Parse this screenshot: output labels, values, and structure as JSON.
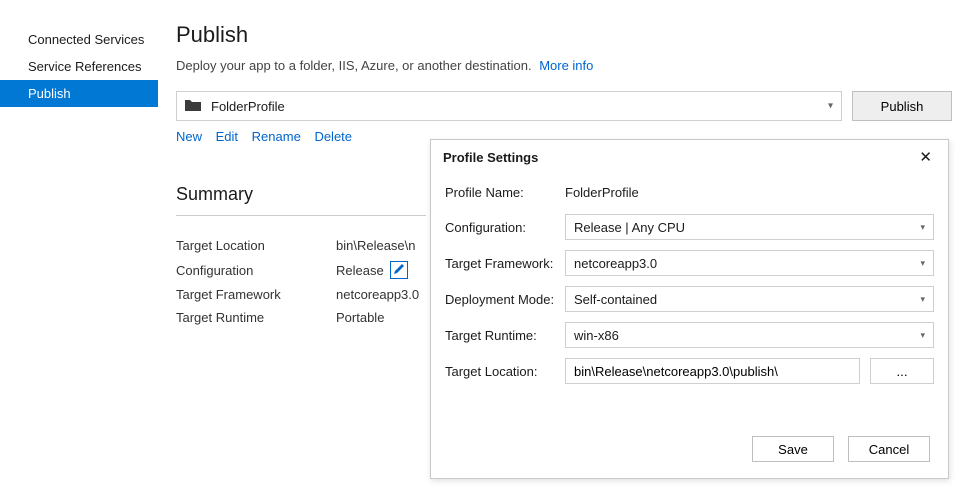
{
  "sidebar": {
    "items": [
      {
        "label": "Connected Services",
        "selected": false
      },
      {
        "label": "Service References",
        "selected": false
      },
      {
        "label": "Publish",
        "selected": true
      }
    ]
  },
  "page": {
    "title": "Publish",
    "subtitle": "Deploy your app to a folder, IIS, Azure, or another destination.",
    "more_info": "More info"
  },
  "profile": {
    "selected": "FolderProfile",
    "publish_button": "Publish",
    "actions": {
      "new": "New",
      "edit": "Edit",
      "rename": "Rename",
      "delete": "Delete"
    }
  },
  "summary": {
    "title": "Summary",
    "rows": {
      "target_location": {
        "label": "Target Location",
        "value": "bin\\Release\\n"
      },
      "configuration": {
        "label": "Configuration",
        "value": "Release"
      },
      "target_framework": {
        "label": "Target Framework",
        "value": "netcoreapp3.0"
      },
      "target_runtime": {
        "label": "Target Runtime",
        "value": "Portable"
      }
    }
  },
  "dialog": {
    "title": "Profile Settings",
    "labels": {
      "profile_name": "Profile Name:",
      "configuration": "Configuration:",
      "target_framework": "Target Framework:",
      "deployment_mode": "Deployment Mode:",
      "target_runtime": "Target Runtime:",
      "target_location": "Target Location:"
    },
    "values": {
      "profile_name": "FolderProfile",
      "configuration": "Release | Any CPU",
      "target_framework": "netcoreapp3.0",
      "deployment_mode": "Self-contained",
      "target_runtime": "win-x86",
      "target_location": "bin\\Release\\netcoreapp3.0\\publish\\"
    },
    "browse": "...",
    "save": "Save",
    "cancel": "Cancel"
  }
}
